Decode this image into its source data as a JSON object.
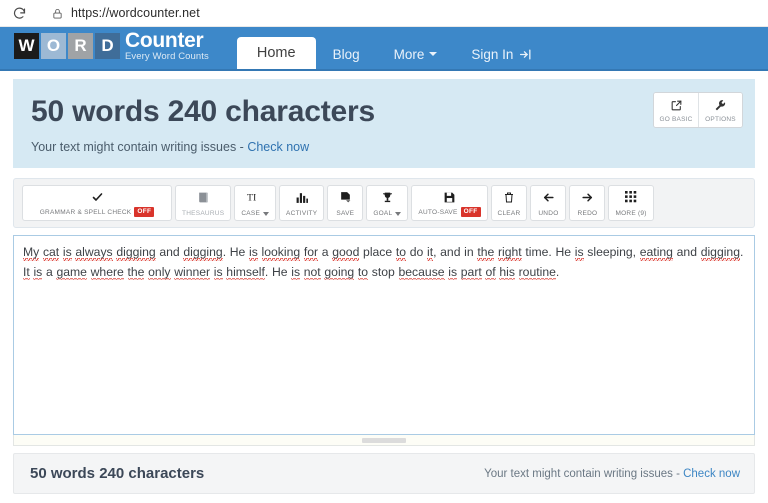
{
  "browser": {
    "url": "https://wordcounter.net",
    "reload_icon": "reload-icon",
    "lock_icon": "padlock-icon"
  },
  "header": {
    "logo": {
      "letters": [
        "W",
        "O",
        "R",
        "D"
      ],
      "word": "Counter",
      "tagline": "Every Word Counts"
    },
    "nav": [
      {
        "label": "Home",
        "active": true,
        "caret": false,
        "icon": null
      },
      {
        "label": "Blog",
        "active": false,
        "caret": false,
        "icon": null
      },
      {
        "label": "More",
        "active": false,
        "caret": true,
        "icon": null
      },
      {
        "label": "Sign In",
        "active": false,
        "caret": false,
        "icon": "sign-in-icon"
      }
    ],
    "brand_color": "#3d88c9"
  },
  "info_panel": {
    "count_heading": "50 words 240 characters",
    "issues_prefix": "Your text might contain writing issues - ",
    "issues_link": "Check now",
    "background_color": "#d6e9f3",
    "buttons": [
      {
        "label": "GO BASIC",
        "icon": "external-link-icon"
      },
      {
        "label": "OPTIONS",
        "icon": "wrench-icon"
      }
    ]
  },
  "toolbar": {
    "items": [
      {
        "label": "GRAMMAR & SPELL CHECK",
        "icon": "checkmark-icon",
        "badge": "OFF",
        "caret": false,
        "wide": true,
        "muted": false
      },
      {
        "label": "THESAURUS",
        "icon": "book-icon",
        "badge": null,
        "caret": false,
        "wide": false,
        "muted": true
      },
      {
        "label": "CASE",
        "icon": "text-case-icon",
        "badge": null,
        "caret": true,
        "wide": false,
        "muted": false
      },
      {
        "label": "ACTIVITY",
        "icon": "bar-chart-icon",
        "badge": null,
        "caret": false,
        "wide": false,
        "muted": false
      },
      {
        "label": "SAVE",
        "icon": "save-page-icon",
        "badge": null,
        "caret": false,
        "wide": false,
        "muted": false
      },
      {
        "label": "GOAL",
        "icon": "trophy-icon",
        "badge": null,
        "caret": true,
        "wide": false,
        "muted": false
      },
      {
        "label": "AUTO-SAVE",
        "icon": "floppy-disk-icon",
        "badge": "OFF",
        "caret": false,
        "wide": false,
        "muted": false
      },
      {
        "label": "CLEAR",
        "icon": "trash-icon",
        "badge": null,
        "caret": false,
        "wide": false,
        "muted": false
      },
      {
        "label": "UNDO",
        "icon": "arrow-left-icon",
        "badge": null,
        "caret": false,
        "wide": false,
        "muted": false
      },
      {
        "label": "REDO",
        "icon": "arrow-right-icon",
        "badge": null,
        "caret": false,
        "wide": false,
        "muted": false
      },
      {
        "label": "MORE (9)",
        "icon": "grid-icon",
        "badge": null,
        "caret": false,
        "wide": false,
        "muted": false
      }
    ],
    "off_badge_color": "#d9342b"
  },
  "editor": {
    "text_plain": "My cat is always digging and digging. He is looking for a good place to do it, and in the right time. He is sleeping, eating and digging. It is a game where the only winner is himself. He is not going to stop because is part of his routine.",
    "tokens": [
      {
        "t": "My",
        "spell": true
      },
      {
        "t": " ",
        "spell": false
      },
      {
        "t": "cat",
        "spell": true
      },
      {
        "t": " ",
        "spell": false
      },
      {
        "t": "is",
        "spell": true
      },
      {
        "t": " ",
        "spell": false
      },
      {
        "t": "always",
        "spell": true
      },
      {
        "t": " ",
        "spell": false
      },
      {
        "t": "digging",
        "spell": true
      },
      {
        "t": " and ",
        "spell": false
      },
      {
        "t": "digging",
        "spell": true
      },
      {
        "t": ". He ",
        "spell": false
      },
      {
        "t": "is",
        "spell": true
      },
      {
        "t": " ",
        "spell": false
      },
      {
        "t": "looking",
        "spell": true
      },
      {
        "t": " ",
        "spell": false
      },
      {
        "t": "for",
        "spell": true
      },
      {
        "t": " a ",
        "spell": false
      },
      {
        "t": "good",
        "spell": true
      },
      {
        "t": " place ",
        "spell": false
      },
      {
        "t": "to",
        "spell": true
      },
      {
        "t": " do ",
        "spell": false
      },
      {
        "t": "it",
        "spell": true
      },
      {
        "t": ", and in ",
        "spell": false
      },
      {
        "t": "the",
        "spell": true
      },
      {
        "t": " ",
        "spell": false
      },
      {
        "t": "right",
        "spell": true
      },
      {
        "t": " time. He ",
        "spell": false
      },
      {
        "t": "is",
        "spell": true
      },
      {
        "t": " sleeping, ",
        "spell": false
      },
      {
        "t": "eating",
        "spell": true
      },
      {
        "t": " and ",
        "spell": false
      },
      {
        "t": "digging",
        "spell": true
      },
      {
        "t": ".",
        "spell": false
      },
      {
        "t": "BREAK",
        "spell": false
      },
      {
        "t": "It",
        "spell": true
      },
      {
        "t": " ",
        "spell": false
      },
      {
        "t": "is",
        "spell": true
      },
      {
        "t": " a ",
        "spell": false
      },
      {
        "t": "game",
        "spell": true
      },
      {
        "t": " ",
        "spell": false
      },
      {
        "t": "where",
        "spell": true
      },
      {
        "t": " ",
        "spell": false
      },
      {
        "t": "the",
        "spell": true
      },
      {
        "t": " ",
        "spell": false
      },
      {
        "t": "only",
        "spell": true
      },
      {
        "t": " ",
        "spell": false
      },
      {
        "t": "winner",
        "spell": true
      },
      {
        "t": " ",
        "spell": false
      },
      {
        "t": "is",
        "spell": true
      },
      {
        "t": " ",
        "spell": false
      },
      {
        "t": "himself",
        "spell": true
      },
      {
        "t": ". He ",
        "spell": false
      },
      {
        "t": "is",
        "spell": true
      },
      {
        "t": " ",
        "spell": false
      },
      {
        "t": "not",
        "spell": true
      },
      {
        "t": " ",
        "spell": false
      },
      {
        "t": "going",
        "spell": true
      },
      {
        "t": " ",
        "spell": false
      },
      {
        "t": "to",
        "spell": true
      },
      {
        "t": " stop ",
        "spell": false
      },
      {
        "t": "because",
        "spell": true
      },
      {
        "t": " ",
        "spell": false
      },
      {
        "t": "is",
        "spell": true
      },
      {
        "t": " ",
        "spell": false
      },
      {
        "t": "part",
        "spell": true
      },
      {
        "t": " ",
        "spell": false
      },
      {
        "t": "of",
        "spell": true
      },
      {
        "t": " ",
        "spell": false
      },
      {
        "t": "his",
        "spell": true
      },
      {
        "t": " ",
        "spell": false
      },
      {
        "t": "routine",
        "spell": true
      },
      {
        "t": ".",
        "spell": false
      }
    ],
    "spellcheck_underline_color": "#e0524a",
    "border_color": "#aacbe4"
  },
  "status_bar": {
    "count": "50 words 240 characters",
    "issues_prefix": "Your text might contain writing issues - ",
    "issues_link": "Check now"
  }
}
